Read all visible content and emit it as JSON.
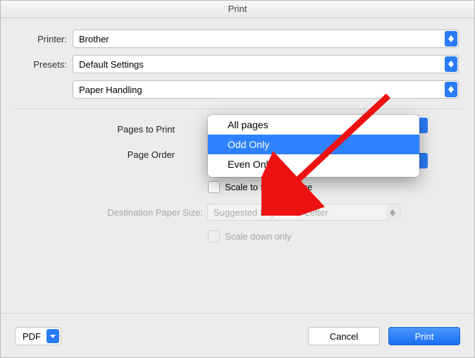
{
  "title": "Print",
  "printer": {
    "label": "Printer:",
    "value": "Brother"
  },
  "presets": {
    "label": "Presets:",
    "value": "Default Settings"
  },
  "section": {
    "value": "Paper Handling"
  },
  "options": {
    "pages_to_print_label": "Pages to Print",
    "page_order_label": "Page Order",
    "scale_fit_label": "Scale to fit paper size",
    "dest_paper_label": "Destination Paper Size:",
    "dest_paper_value": "Suggested Paper: US Letter",
    "scale_down_label": "Scale down only"
  },
  "popup": {
    "items": [
      "All pages",
      "Odd Only",
      "Even Only"
    ],
    "selected_index": 1
  },
  "footer": {
    "pdf": "PDF",
    "cancel": "Cancel",
    "print": "Print"
  }
}
